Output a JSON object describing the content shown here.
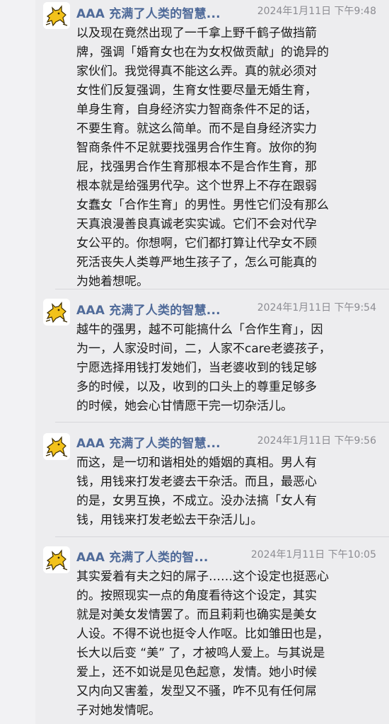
{
  "messages": [
    {
      "author": "AAA 充满了人类的智慧...",
      "time": "2024年1月11日 下午9:48",
      "avatar_icon": "cat-sticker-icon",
      "lines": [
        "以及现在竟然出现了一千拿上野千鹤子做挡箭",
        "牌，强调「婚育女也在为女权做贡献」的诡异的",
        "家伙们。我觉得真不能这么弄。真的就必须对",
        "女性们反复强调，生育女性要尽量无婚生育，",
        "单身生育，自身经济实力智商条件不足的话，",
        "不要生育。就这么简单。而不是自身经济实力",
        "智商条件不足就要找强男合作生育。放你的狗",
        "屁，找强男合作生育那根本不是合作生育，那",
        "根本就是给强男代孕。这个世界上不存在跟弱",
        "女蠢女「合作生育」的男性。男性它们没有那么",
        "天真浪漫善良真诚老实实诚。它们不会对代孕",
        "女公平的。你想啊，它们都打算让代孕女不顾",
        "死活丧失人类尊严地生孩子了，怎么可能真的",
        "为她着想呢。"
      ]
    },
    {
      "author": "AAA 充满了人类的智慧...",
      "time": "2024年1月11日 下午9:54",
      "avatar_icon": "cat-sticker-icon",
      "lines": [
        "越牛的强男，越不可能搞什么「合作生育」，因",
        "为一，人家没时间，二，人家不care老婆孩子，",
        "宁愿选择用钱打发她们，当老婆收到的钱足够",
        "多的时候，以及，收到的口头上的尊重足够多",
        "的时候，她会心甘情愿干完一切杂活儿。"
      ]
    },
    {
      "author": "AAA 充满了人类的智慧...",
      "time": "2024年1月11日 下午9:56",
      "avatar_icon": "cat-sticker-icon",
      "lines": [
        "而这，是一切和谐相处的婚姻的真相。男人有",
        "钱，用钱来打发老婆去干杂活。而且，最恶心",
        "的是，女男互换，不成立。没办法搞「女人有",
        "钱，用钱来打发老蚣去干杂活儿」。"
      ]
    },
    {
      "author": "AAA 充满了人类的智...",
      "time": "2024年1月11日 下午10:05",
      "avatar_icon": "cat-sticker-icon",
      "lines": [
        "其实爱着有夫之妇的屌子……这个设定也挺恶心",
        "的。按照现实一点的角度看待这个设定，其实",
        "就是对美女发情罢了。而且莉莉也确实是美女",
        "人设。不得不说也挺令人作呕。比如雏田也是，",
        "长大以后变 “美” 了，才被鸣人爱上。与其说是",
        "爱上，还不如说是见色起意，发情。她小时候",
        "又内向又害羞，发型又不骚，咋不见有任何屌",
        "子对她发情呢。"
      ]
    }
  ]
}
